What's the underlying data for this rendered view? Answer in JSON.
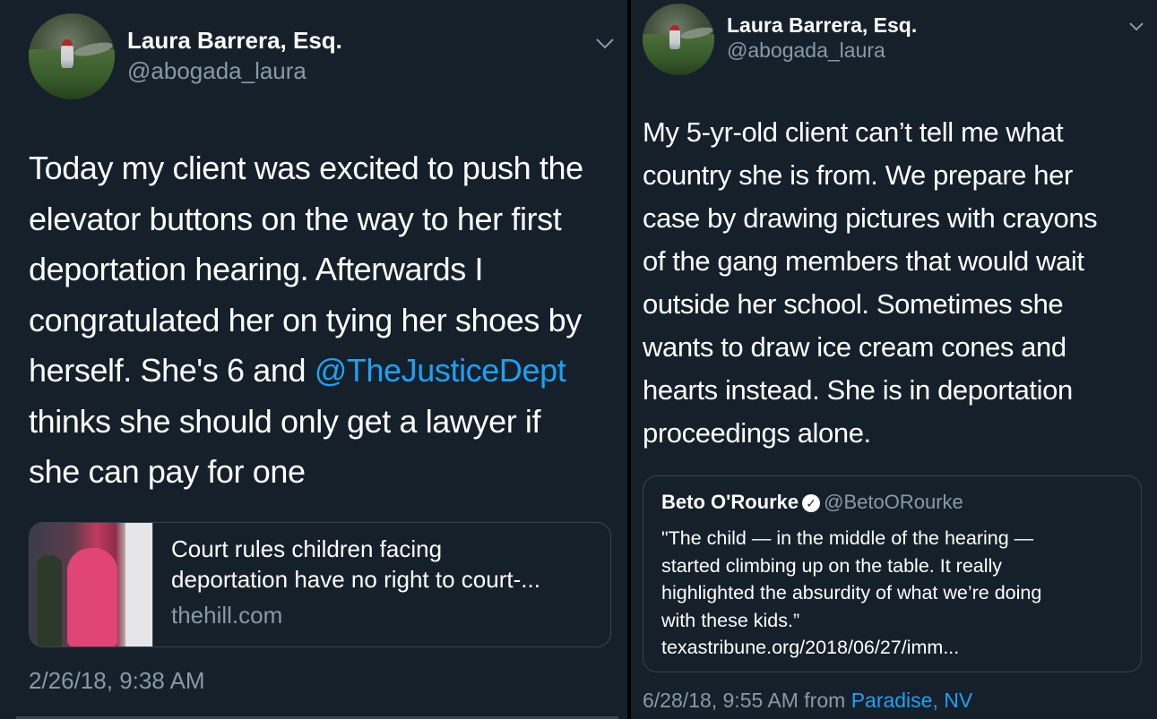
{
  "left_tweet": {
    "author": {
      "name": "Laura Barrera, Esq.",
      "handle": "@abogada_laura"
    },
    "menu_icon": "chevron-down-icon",
    "text_lines": [
      "Today my client was excited to push the",
      "elevator buttons on the way to her first",
      "deportation hearing.  Afterwards I",
      "congratulated her on tying her shoes by",
      "herself.  She's 6 and ",
      "thinks she should only get a lawyer if",
      "she can pay for one"
    ],
    "mention": "@TheJusticeDept",
    "link_card": {
      "title_lines": [
        "Court rules children facing",
        "deportation have no right to court-..."
      ],
      "domain": "thehill.com"
    },
    "timestamp": "2/26/18, 9:38 AM"
  },
  "right_tweet": {
    "author": {
      "name": "Laura Barrera, Esq.",
      "handle": "@abogada_laura"
    },
    "menu_icon": "chevron-down-icon",
    "text_lines": [
      "My 5-yr-old client can’t tell me what",
      "country she is from. We prepare her",
      "case by drawing pictures with crayons",
      "of the gang members that would wait",
      "outside her school.  Sometimes she",
      "wants to draw ice cream cones and",
      "hearts instead.  She is in deportation",
      "proceedings alone."
    ],
    "quoted_tweet": {
      "name": "Beto O'Rourke",
      "verified_icon": "verified-badge-icon",
      "handle": "@BetoORourke",
      "text_lines": [
        "\"The child — in the middle of the hearing —",
        "started climbing up on the table. It really",
        "highlighted the absurdity of what we’re doing",
        "with these kids.”",
        "texastribune.org/2018/06/27/imm..."
      ]
    },
    "timestamp": "6/28/18, 9:55 AM from ",
    "location": "Paradise, NV"
  },
  "colors": {
    "background": "#15202b",
    "divider": "#000000",
    "text": "#ffffff",
    "secondary_text": "#8899a6",
    "link": "#1da1f2",
    "border": "#38444d"
  }
}
